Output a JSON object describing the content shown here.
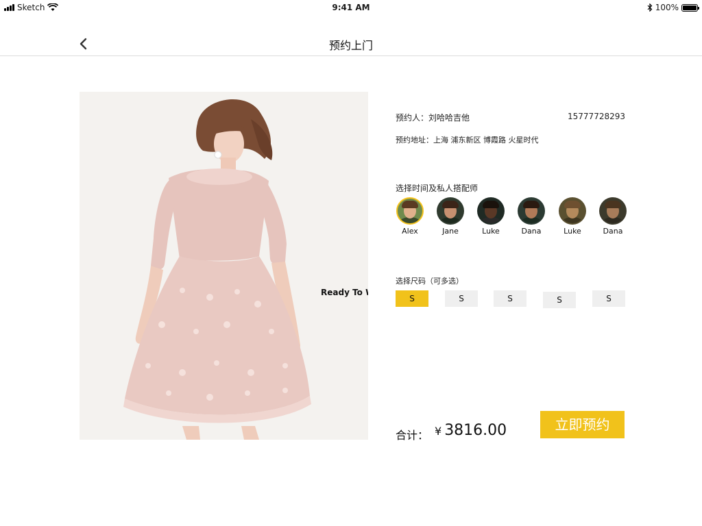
{
  "status_bar": {
    "carrier": "Sketch",
    "time": "9:41 AM",
    "battery": "100%",
    "battery_level": 1.0,
    "signal_icon": "signal-bars-icon",
    "wifi_icon": "wifi-icon",
    "bluetooth_icon": "bluetooth-icon"
  },
  "nav": {
    "title": "预约上门",
    "back_icon": "chevron-left-icon"
  },
  "product": {
    "image": "model-in-pink-lace-dress",
    "caption": "Ready To W"
  },
  "booking": {
    "contact_label": "预约人：",
    "contact_name": "刘哈哈吉他",
    "phone": "15777728293",
    "address_label": "预约地址：",
    "address": "上海 浦东新区 博霞路 火星时代"
  },
  "stylist_section": {
    "title": "选择时间及私人搭配师",
    "stylists": [
      {
        "name": "Alex",
        "selected": true
      },
      {
        "name": "Jane",
        "selected": false
      },
      {
        "name": "Luke",
        "selected": false
      },
      {
        "name": "Dana",
        "selected": false
      },
      {
        "name": "Luke",
        "selected": false
      },
      {
        "name": "Dana",
        "selected": false
      }
    ]
  },
  "size_section": {
    "title": "选择尺码（可多选）",
    "sizes": [
      {
        "label": "S",
        "active": true
      },
      {
        "label": "S",
        "active": false
      },
      {
        "label": "S",
        "active": false
      },
      {
        "label": "S",
        "active": false
      },
      {
        "label": "S",
        "active": false
      }
    ]
  },
  "summary": {
    "total_label": "合计：",
    "currency": "¥",
    "total": "3816.00",
    "book_button": "立即预约"
  },
  "colors": {
    "accent": "#f1c21b",
    "size_default": "#efefef",
    "divider": "#dcdcdc"
  }
}
